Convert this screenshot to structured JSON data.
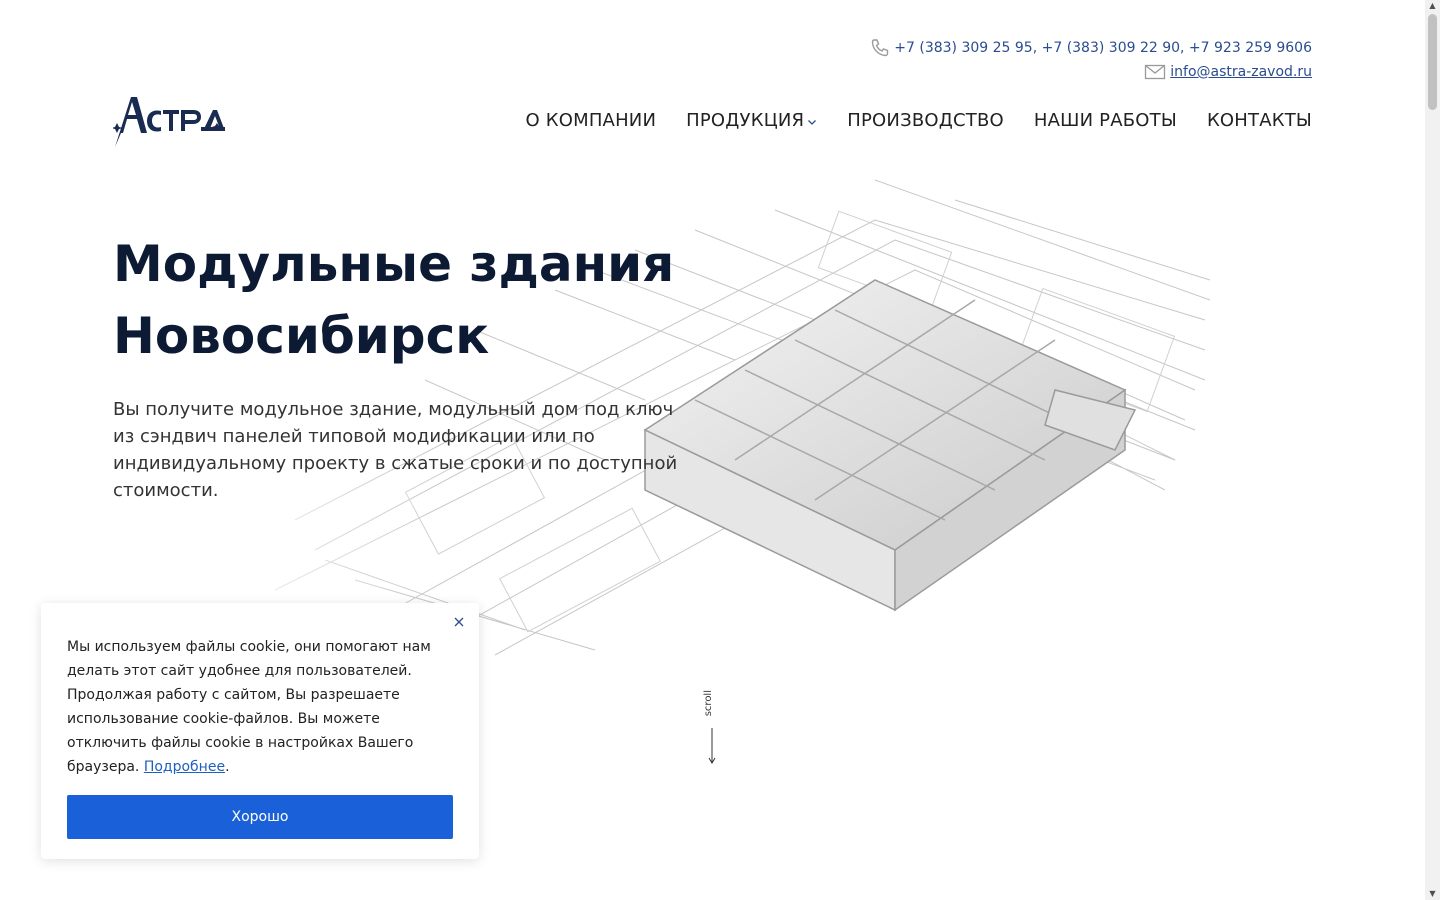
{
  "header": {
    "phones": "+7 (383) 309 25 95, +7 (383) 309 22 90, +7 923 259 9606",
    "email": "info@astra-zavod.ru",
    "phone_icon": "phone-icon",
    "email_icon": "mail-icon"
  },
  "logo": {
    "text": "АСТРА",
    "color": "#1a2b52"
  },
  "nav": {
    "items": [
      {
        "label": "О КОМПАНИИ"
      },
      {
        "label": "ПРОДУКЦИЯ",
        "has_dropdown": true
      },
      {
        "label": "ПРОИЗВОДСТВО"
      },
      {
        "label": "НАШИ РАБОТЫ"
      },
      {
        "label": "КОНТАКТЫ"
      }
    ]
  },
  "hero": {
    "title_line1": "Модульные здания",
    "title_line2": "Новосибирск",
    "text": "Вы получите модульное здание, модульный дом под ключ из сэндвич панелей типовой модификации или по индивидуальному проекту в сжатые сроки и по доступной стоимости."
  },
  "scroll_hint": {
    "label": "scroll"
  },
  "cookie": {
    "text": "Мы используем файлы cookie, они помогают нам делать этот сайт удобнее для пользователей. Продолжая работу с сайтом, Вы разрешаете использование cookie-файлов. Вы можете отключить файлы cookie в настройках Вашего браузера. ",
    "link": "Подробнее",
    "after_link": ".",
    "button": "Хорошо"
  },
  "colors": {
    "accent": "#1a61d9",
    "link": "#2b4d8f",
    "title": "#0d1a33"
  }
}
